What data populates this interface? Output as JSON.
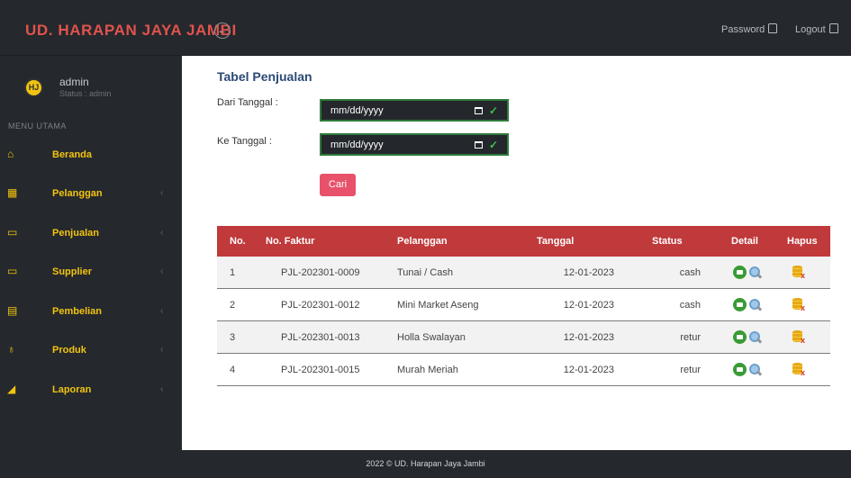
{
  "header": {
    "brand": "UD. HARAPAN JAYA JAMBI",
    "toggle_icon": "←",
    "password_label": "Password",
    "logout_label": "Logout"
  },
  "sidebar": {
    "avatar_text": "HJ",
    "username": "admin",
    "status": "Status : admin",
    "menu_header": "MENU UTAMA",
    "items": [
      {
        "label": "Beranda",
        "icon": "home-icon",
        "has_children": false
      },
      {
        "label": "Pelanggan",
        "icon": "grid-icon",
        "has_children": true
      },
      {
        "label": "Penjualan",
        "icon": "window-icon",
        "has_children": true
      },
      {
        "label": "Supplier",
        "icon": "monitor-icon",
        "has_children": true
      },
      {
        "label": "Pembelian",
        "icon": "clipboard-icon",
        "has_children": true
      },
      {
        "label": "Produk",
        "icon": "medal-icon",
        "has_children": true
      },
      {
        "label": "Laporan",
        "icon": "chart-icon",
        "has_children": true
      }
    ]
  },
  "main": {
    "title": "Tabel Penjualan",
    "filter": {
      "from_label": "Dari Tanggal :",
      "from_placeholder": "mm/dd/yyyy",
      "to_label": "Ke Tanggal :",
      "to_placeholder": "mm/dd/yyyy",
      "search_button": "Cari"
    },
    "table": {
      "headers": [
        "No.",
        "No. Faktur",
        "Pelanggan",
        "Tanggal",
        "Status",
        "Detail",
        "Hapus"
      ],
      "rows": [
        {
          "no": "1",
          "faktur": "PJL-202301-0009",
          "pelanggan": "Tunai / Cash",
          "tanggal": "12-01-2023",
          "status": "cash"
        },
        {
          "no": "2",
          "faktur": "PJL-202301-0012",
          "pelanggan": "Mini Market Aseng",
          "tanggal": "12-01-2023",
          "status": "cash"
        },
        {
          "no": "3",
          "faktur": "PJL-202301-0013",
          "pelanggan": "Holla Swalayan",
          "tanggal": "12-01-2023",
          "status": "retur"
        },
        {
          "no": "4",
          "faktur": "PJL-202301-0015",
          "pelanggan": "Murah Meriah",
          "tanggal": "12-01-2023",
          "status": "retur"
        }
      ]
    }
  },
  "footer": {
    "text": "2022 © UD. Harapan Jaya Jambi"
  },
  "colors": {
    "brand": "#e0534d",
    "sidebar_accent": "#f1c40f",
    "table_header": "#c0393b",
    "button": "#e7526a",
    "title": "#2c4a75"
  }
}
